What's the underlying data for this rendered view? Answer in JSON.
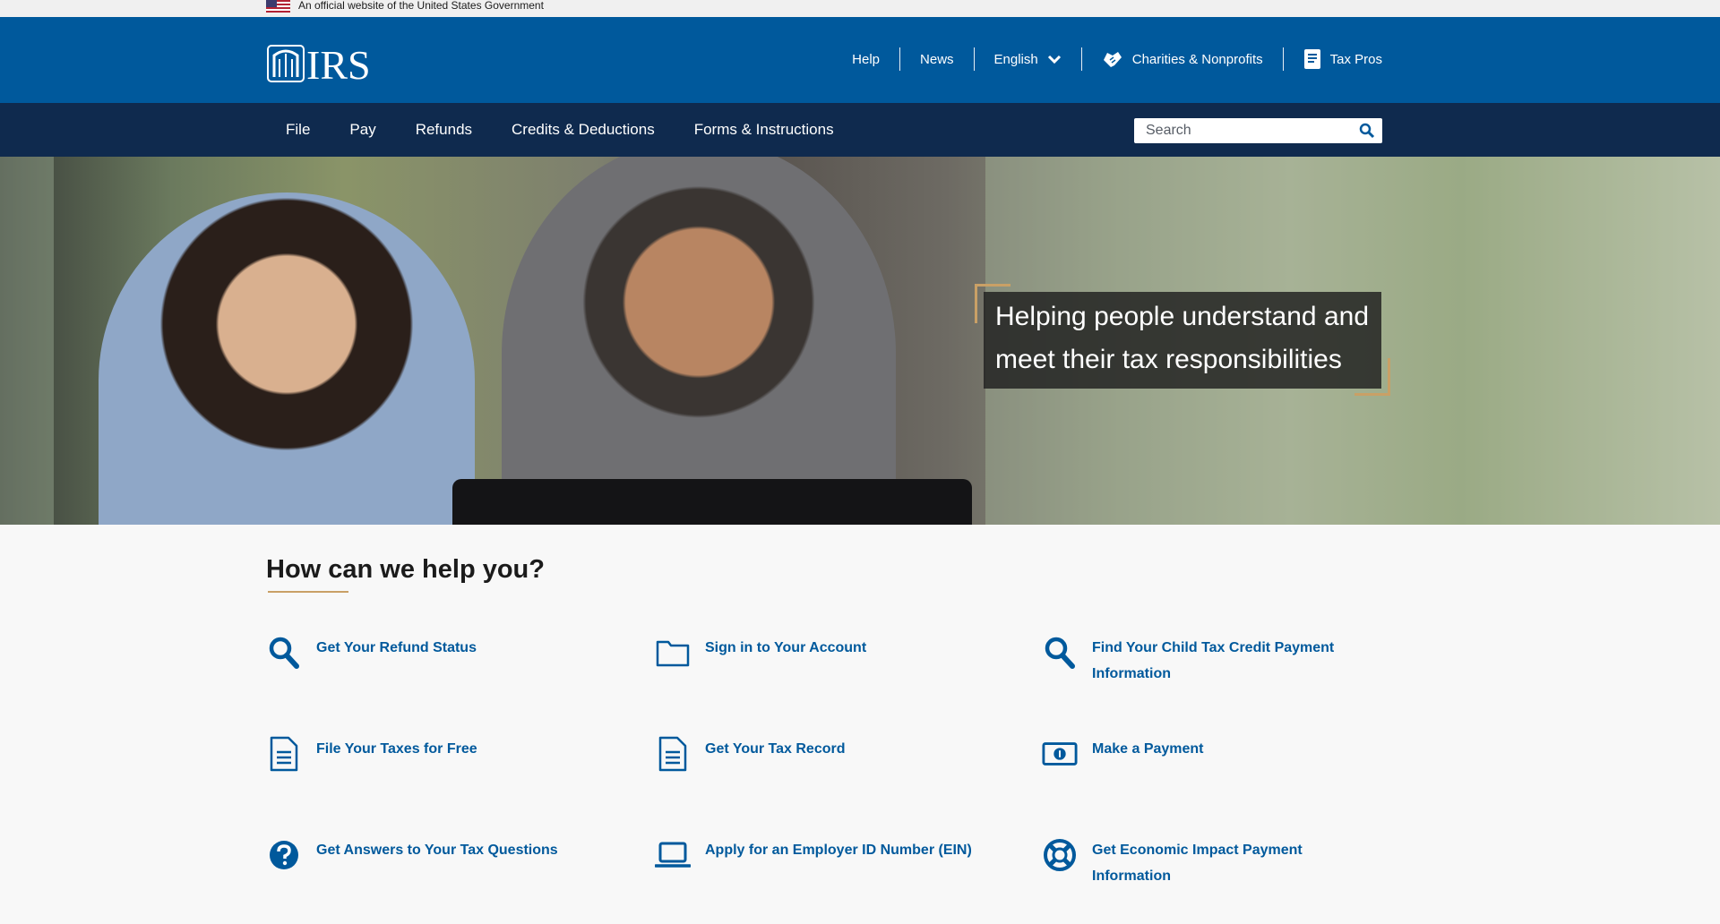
{
  "gov_banner": {
    "text": "An official website of the United States Government"
  },
  "header": {
    "logo_text": "IRS",
    "utility_nav": [
      {
        "label": "Help"
      },
      {
        "label": "News"
      },
      {
        "label": "English",
        "icon": "chevron-down-icon"
      },
      {
        "label": "Charities & Nonprofits",
        "icon": "handshake-icon"
      },
      {
        "label": "Tax Pros",
        "icon": "book-icon"
      }
    ]
  },
  "main_nav": {
    "items": [
      {
        "label": "File"
      },
      {
        "label": "Pay"
      },
      {
        "label": "Refunds"
      },
      {
        "label": "Credits & Deductions"
      },
      {
        "label": "Forms & Instructions"
      }
    ],
    "search": {
      "placeholder": "Search"
    }
  },
  "hero": {
    "caption": "Helping people understand and meet their tax responsibilities"
  },
  "help": {
    "title": "How can we help you?",
    "cards": [
      {
        "label": "Get Your Refund Status",
        "icon": "search-icon"
      },
      {
        "label": "Sign in to Your Account",
        "icon": "folder-icon"
      },
      {
        "label": "Find Your Child Tax Credit Payment Information",
        "icon": "search-icon"
      },
      {
        "label": "File Your Taxes for Free",
        "icon": "document-icon"
      },
      {
        "label": "Get Your Tax Record",
        "icon": "document-icon"
      },
      {
        "label": "Make a Payment",
        "icon": "money-icon"
      },
      {
        "label": "Get Answers to Your Tax Questions",
        "icon": "question-icon"
      },
      {
        "label": "Apply for an Employer ID Number (EIN)",
        "icon": "laptop-icon"
      },
      {
        "label": "Get Economic Impact Payment Information",
        "icon": "lifebuoy-icon"
      }
    ]
  },
  "colors": {
    "primary_blue": "#00599c",
    "nav_navy": "#0f2a4e",
    "accent_gold": "#c9a066"
  }
}
